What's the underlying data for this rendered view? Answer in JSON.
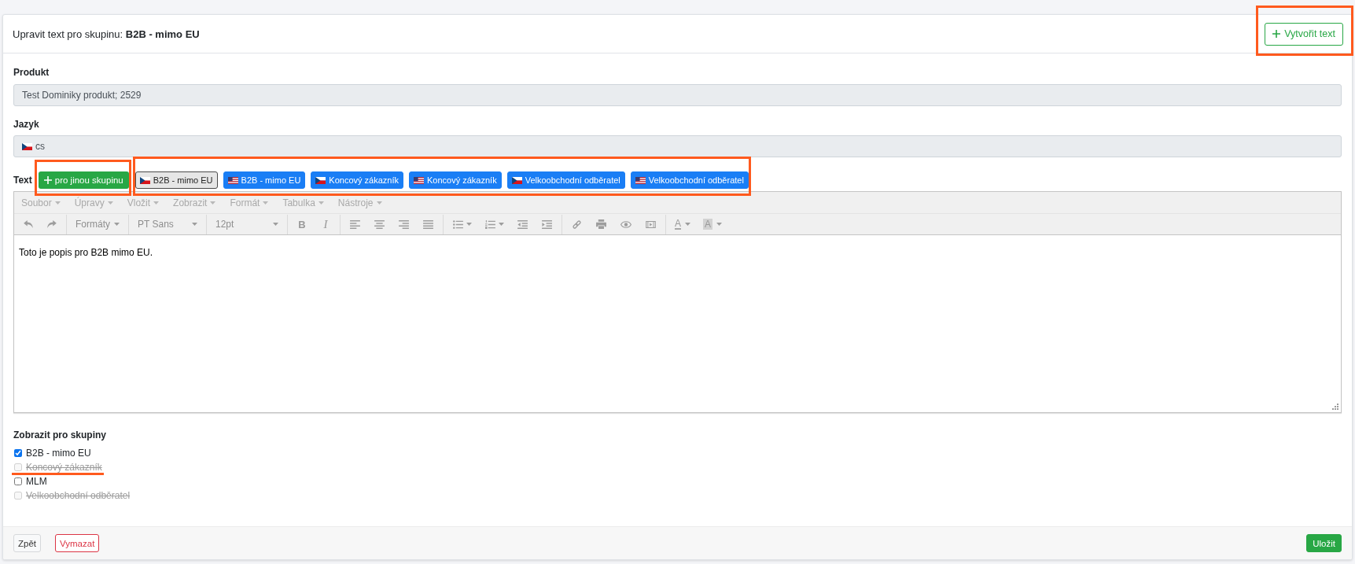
{
  "header": {
    "title": "Upravit text pro skupinu: **B2B - mimo EU**",
    "create_button": {
      "label": "Vytvořit text",
      "highlighted": true
    }
  },
  "fields": [
    {
      "label": "Produkt",
      "value": "Test Dominiky produkt; 2529"
    },
    {
      "label": "Jazyk",
      "value": "cs",
      "kind": "cz"
    }
  ],
  "text_editor": {
    "label": "Text",
    "add_group_button": {
      "label": "pro jinou skupinu",
      "highlighted": true
    },
    "group_bar": {
      "highlighted": true,
      "buttons": [
        {
          "label": "B2B - mimo EU",
          "kind": "cz",
          "selected": true
        },
        {
          "label": "B2B - mimo EU",
          "kind": "us",
          "selected": false
        },
        {
          "label": "Koncový zákazník",
          "kind": "cz",
          "selected": false
        },
        {
          "label": "Koncový zákazník",
          "kind": "us",
          "selected": false
        },
        {
          "label": "Velkoobchodní odběratel",
          "kind": "cz",
          "selected": false
        },
        {
          "label": "Velkoobchodní odběratel",
          "kind": "us",
          "selected": false
        }
      ]
    },
    "menu": [
      "Soubor",
      "Úpravy",
      "Vložit",
      "Zobrazit",
      "Formát",
      "Tabulka",
      "Nástroje"
    ],
    "toolbar": {
      "formats": "Formáty",
      "font_family": "PT Sans",
      "font_size": "12pt",
      "bold": "B",
      "italic": "I",
      "text_color": "A",
      "background_color": "A"
    },
    "content": "Toto je popis pro B2B mimo EU."
  },
  "visibility": {
    "label": "Zobrazit pro skupiny",
    "groups": [
      {
        "label": "B2B - mimo EU",
        "checked": true,
        "disabled": false,
        "highlighted": false
      },
      {
        "label": "Koncový zákazník",
        "checked": false,
        "disabled": true,
        "highlighted": true
      },
      {
        "label": "MLM",
        "checked": false,
        "disabled": false,
        "highlighted": false
      },
      {
        "label": "Velkoobchodní odběratel",
        "checked": false,
        "disabled": true,
        "highlighted": false
      }
    ]
  },
  "footer": {
    "buttons": [
      {
        "label": "Zpět",
        "kind": "secondary"
      },
      {
        "label": "Vymazat",
        "kind": "danger"
      },
      {
        "label": "Uložit",
        "kind": "success"
      }
    ]
  }
}
